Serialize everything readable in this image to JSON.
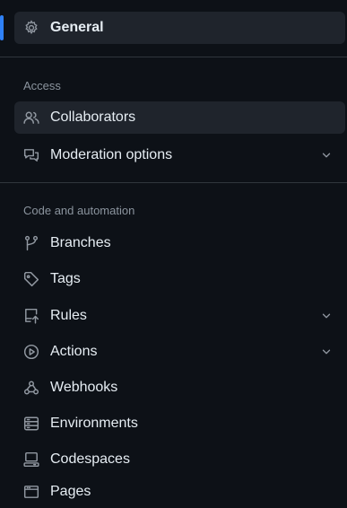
{
  "nav": {
    "general": {
      "label": "General",
      "icon": "gear-icon"
    },
    "access": {
      "title": "Access",
      "items": [
        {
          "label": "Collaborators",
          "icon": "people-icon"
        },
        {
          "label": "Moderation options",
          "icon": "comment-discussion-icon"
        }
      ]
    },
    "code": {
      "title": "Code and automation",
      "items": [
        {
          "label": "Branches",
          "icon": "git-branch-icon"
        },
        {
          "label": "Tags",
          "icon": "tag-icon"
        },
        {
          "label": "Rules",
          "icon": "repo-push-icon"
        },
        {
          "label": "Actions",
          "icon": "play-icon"
        },
        {
          "label": "Webhooks",
          "icon": "webhook-icon"
        },
        {
          "label": "Environments",
          "icon": "server-icon"
        },
        {
          "label": "Codespaces",
          "icon": "codespaces-icon"
        },
        {
          "label": "Pages",
          "icon": "browser-icon"
        }
      ]
    }
  },
  "colors": {
    "background": "#0d1117",
    "active_bar": "#2f81f7",
    "active_bg": "#1f242c",
    "muted": "#8b949e",
    "divider": "#30363d",
    "text": "#e6edf3"
  }
}
